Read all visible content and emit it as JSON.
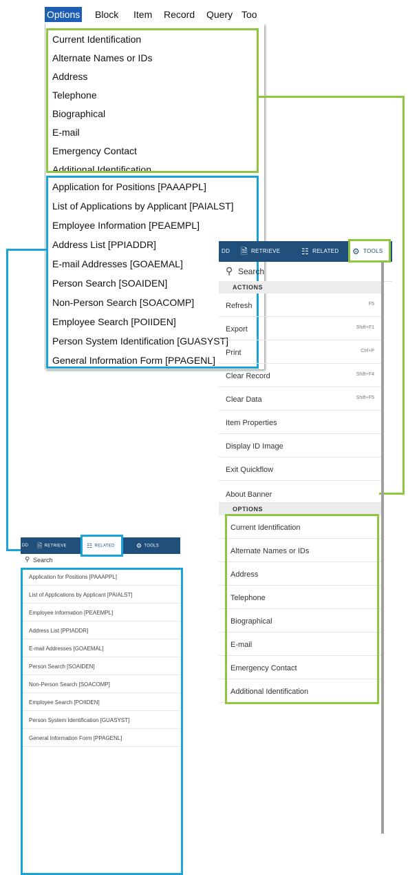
{
  "menubar": {
    "items": [
      "Options",
      "Block",
      "Item",
      "Record",
      "Query",
      "Too"
    ]
  },
  "classic_menu": {
    "options_items": [
      "Current Identification",
      "Alternate Names or IDs",
      "Address",
      "Telephone",
      "Biographical",
      "E-mail",
      "Emergency Contact",
      "Additional Identification"
    ],
    "related_items": [
      "Application for Positions [PAAAPPL]",
      "List of Applications by Applicant [PAIALST]",
      "Employee Information [PEAEMPL]",
      "Address List [PPIADDR]",
      "E-mail Addresses [GOAEMAL]",
      "Person Search [SOAIDEN]",
      "Non-Person Search [SOACOMP]",
      "Employee Search [POIIDEN]",
      "Person System Identification [GUASYST]",
      "General Information Form [PPAGENL]"
    ]
  },
  "tools_panel": {
    "toolbar": {
      "partial": "DD",
      "retrieve": "RETRIEVE",
      "related": "RELATED",
      "tools": "TOOLS"
    },
    "search_placeholder": "Search",
    "actions_header": "ACTIONS",
    "actions": [
      {
        "label": "Refresh",
        "shortcut": "F5"
      },
      {
        "label": "Export",
        "shortcut": "Shift+F1"
      },
      {
        "label": "Print",
        "shortcut": "Ctrl+P"
      },
      {
        "label": "Clear Record",
        "shortcut": "Shift+F4"
      },
      {
        "label": "Clear Data",
        "shortcut": "Shift+F5"
      },
      {
        "label": "Item Properties",
        "shortcut": ""
      },
      {
        "label": "Display ID Image",
        "shortcut": ""
      },
      {
        "label": "Exit Quickflow",
        "shortcut": ""
      },
      {
        "label": "About Banner",
        "shortcut": ""
      }
    ],
    "options_header": "OPTIONS",
    "options": [
      "Current Identification",
      "Alternate Names or IDs",
      "Address",
      "Telephone",
      "Biographical",
      "E-mail",
      "Emergency Contact",
      "Additional Identification"
    ]
  },
  "related_panel": {
    "toolbar": {
      "partial": "DD",
      "retrieve": "RETRIEVE",
      "related": "RELATED",
      "tools": "TOOLS"
    },
    "search_placeholder": "Search",
    "items": [
      "Application for Positions [PAAAPPL]",
      "List of Applications by Applicant [PAIALST]",
      "Employee Information [PEAEMPL]",
      "Address List [PPIADDR]",
      "E-mail Addresses [GOAEMAL]",
      "Person Search [SOAIDEN]",
      "Non-Person Search [SOACOMP]",
      "Employee Search [POIIDEN]",
      "Person System Identification [GUASYST]",
      "General Information Form [PPAGENL]"
    ]
  },
  "colors": {
    "green_highlight": "#8dc63f",
    "blue_highlight": "#1aa3d9",
    "toolbar_bg": "#1f4f7a",
    "menu_active": "#1d5fb3"
  }
}
